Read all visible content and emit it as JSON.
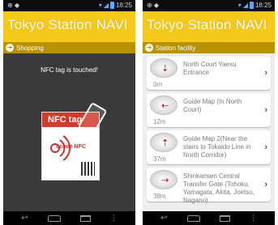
{
  "status_bar": {
    "time": "18:25"
  },
  "app": {
    "title": "Tokyo Station NAVI"
  },
  "left_screen": {
    "breadcrumb": "Shopping",
    "message": "NFC tag is touched!",
    "tag_label": "NFC tag",
    "tag_brand": "ucode NFC"
  },
  "right_screen": {
    "breadcrumb": "Station facility",
    "items": [
      {
        "name": "North Court Yaesu Entrance",
        "distance": "0m"
      },
      {
        "name": "Guide Map (In North Court)",
        "distance": "12m"
      },
      {
        "name": "Guide Map 2(Near the stairs to Tokaido Line in North Corridor)",
        "distance": "37m"
      },
      {
        "name": "Shinkansen Central Transfer Gate (Tohoku, Yamagata, Akita, Joetsu, Nagano)",
        "distance": "38m"
      }
    ]
  },
  "icons": {
    "breadcrumb": "arrow-right-circle-icon",
    "item": "compass-icon",
    "chevron": "chevron-right-icon",
    "nav": [
      "back-icon",
      "home-icon",
      "recent-apps-icon",
      "menu-icon"
    ]
  },
  "colors": {
    "appbar": "#f6c81a",
    "breadcrumb": "#b89200",
    "nfc_red": "#d23a2a"
  }
}
